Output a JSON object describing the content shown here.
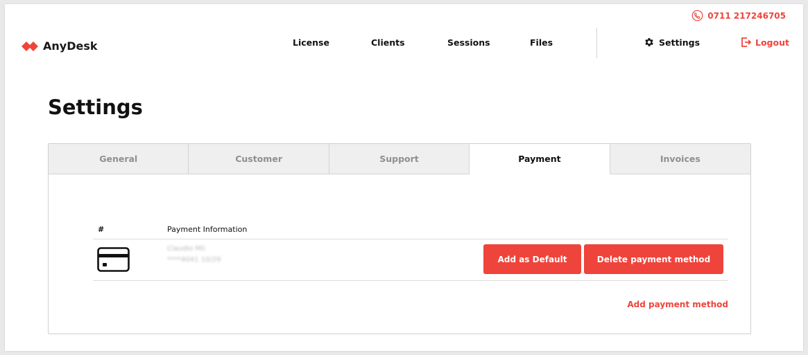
{
  "header": {
    "phone": "0711 217246705",
    "brand": "AnyDesk",
    "nav": [
      "License",
      "Clients",
      "Sessions",
      "Files"
    ],
    "settings_label": "Settings",
    "logout_label": "Logout"
  },
  "page": {
    "title": "Settings"
  },
  "tabs": [
    {
      "label": "General",
      "active": false
    },
    {
      "label": "Customer",
      "active": false
    },
    {
      "label": "Support",
      "active": false
    },
    {
      "label": "Payment",
      "active": true
    },
    {
      "label": "Invoices",
      "active": false
    }
  ],
  "table": {
    "columns": [
      "#",
      "Payment Information"
    ],
    "rows": [
      {
        "icon": "credit-card-icon",
        "holder": "Claudio Mii",
        "number": "****4041 10/29"
      }
    ],
    "add_default_label": "Add as Default",
    "delete_label": "Delete payment method"
  },
  "add_payment_label": "Add payment method",
  "colors": {
    "accent": "#ef443b",
    "text": "#111111",
    "muted": "#8f8f8f"
  }
}
